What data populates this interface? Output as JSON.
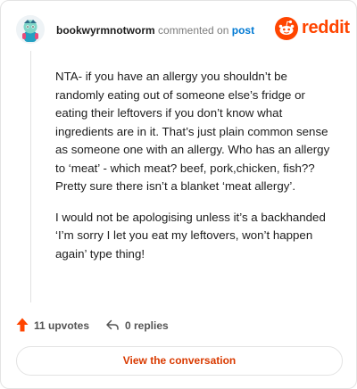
{
  "comment": {
    "username": "bookwyrmnotworm",
    "action_text": "commented on",
    "target_text": "post",
    "paragraphs": [
      "NTA- if you have an allergy you shouldn’t be randomly eating out of someone else’s fridge or eating their leftovers if you don’t know what ingredients are in it. That’s just plain common sense as someone one with an allergy. Who has an allergy to ‘meat’ - which meat? beef, pork,chicken, fish?? Pretty sure there isn’t a blanket ‘meat allergy’.",
      "I would not be apologising unless it’s a backhanded ‘I’m sorry I let you eat my leftovers, won’t happen again’ type thing!"
    ],
    "upvotes": "11 upvotes",
    "replies": "0 replies"
  },
  "brand": {
    "name": "reddit",
    "icon": "reddit-alien-icon",
    "color": "#ff4500"
  },
  "cta": {
    "label": "View the conversation",
    "color": "#d93a00"
  },
  "colors": {
    "link": "#0079d3",
    "upvote": "#ff4500",
    "muted": "#7c7c7c"
  }
}
